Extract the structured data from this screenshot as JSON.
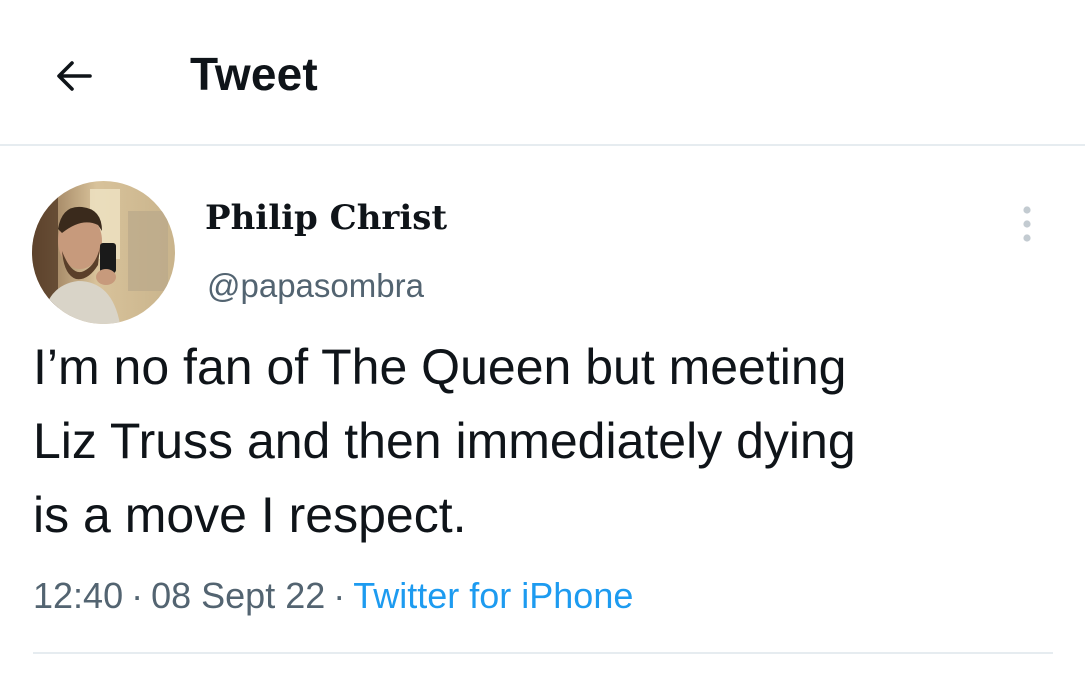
{
  "header": {
    "back_icon": "arrow-left-icon",
    "title": "Tweet"
  },
  "tweet": {
    "author": {
      "display_name": "Philip Christ",
      "handle": "@papasombra",
      "avatar_icon": "profile-photo"
    },
    "more_icon": "more-vertical-icon",
    "text_lines": [
      "I’m no fan of The Queen but meeting",
      "Liz Truss and then immediately dying",
      "is a move I respect."
    ],
    "time": "12:40",
    "separator": "·",
    "date": "08 Sept 22",
    "source": "Twitter for iPhone"
  },
  "colors": {
    "text": "#0f1419",
    "secondary": "#536471",
    "link": "#1d9bf0",
    "divider": "#e6ecf0"
  }
}
